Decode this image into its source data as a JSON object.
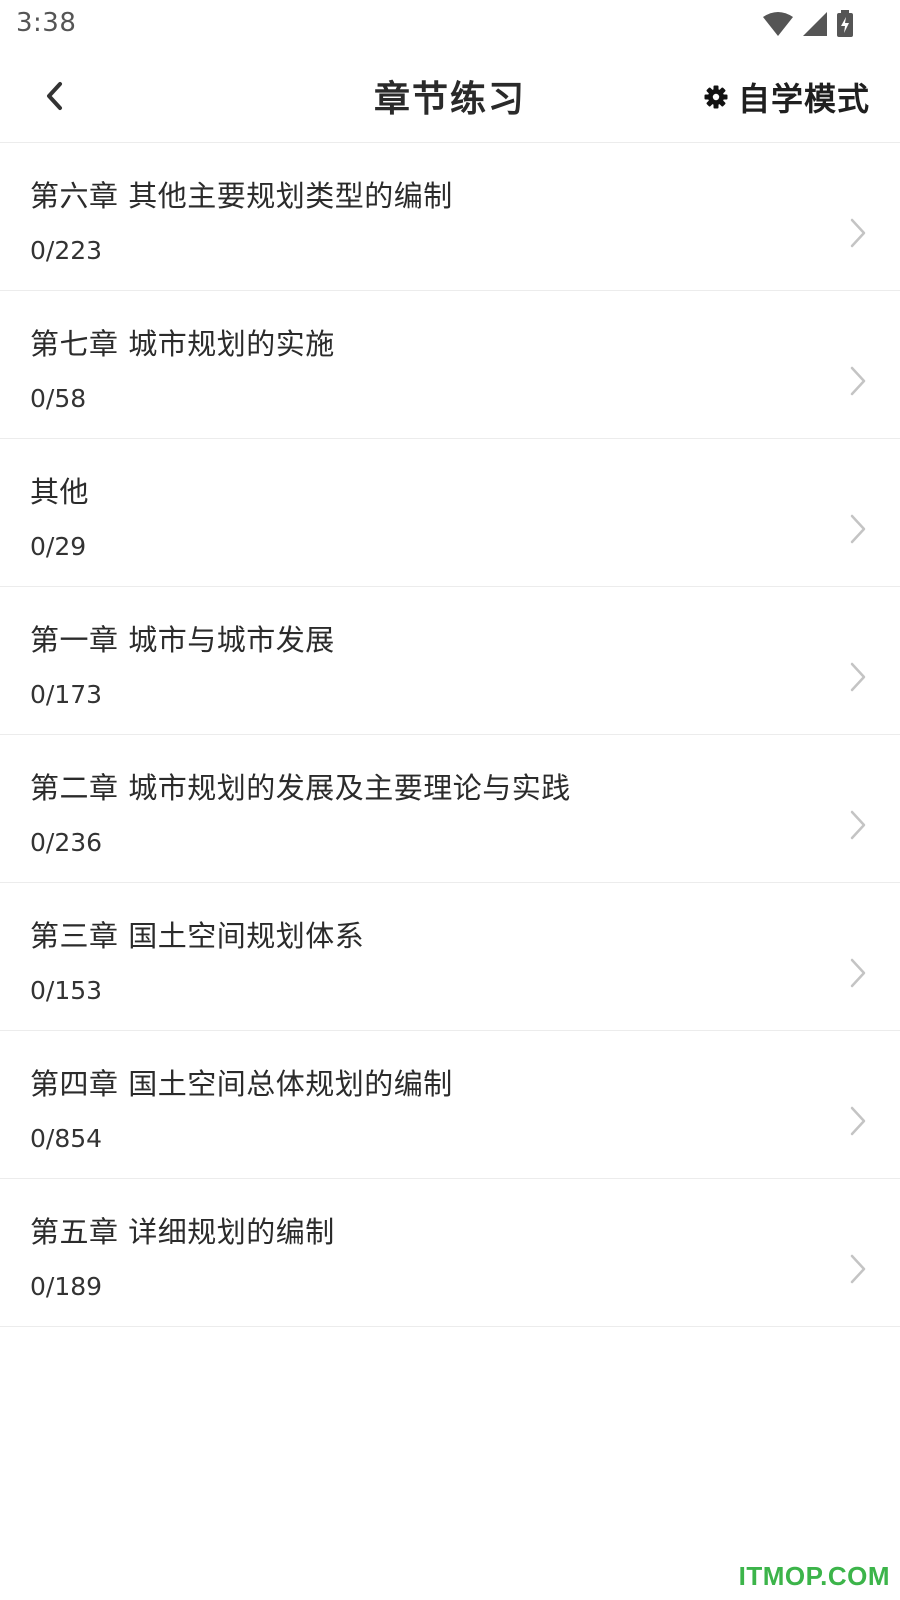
{
  "status_bar": {
    "time": "3:38",
    "icons": [
      "wifi-icon",
      "cell-signal-icon",
      "battery-charging-icon"
    ]
  },
  "header": {
    "title": "章节练习",
    "mode_label": "自学模式",
    "back_icon": "chevron-left-icon",
    "mode_icon": "gear-icon"
  },
  "chapters": [
    {
      "title": "第六章 其他主要规划类型的编制",
      "progress": "0/223"
    },
    {
      "title": "第七章 城市规划的实施",
      "progress": "0/58"
    },
    {
      "title": "其他",
      "progress": "0/29"
    },
    {
      "title": "第一章 城市与城市发展",
      "progress": "0/173"
    },
    {
      "title": "第二章 城市规划的发展及主要理论与实践",
      "progress": "0/236"
    },
    {
      "title": "第三章 国土空间规划体系",
      "progress": "0/153"
    },
    {
      "title": "第四章 国土空间总体规划的编制",
      "progress": "0/854"
    },
    {
      "title": "第五章 详细规划的编制",
      "progress": "0/189"
    }
  ],
  "watermark": "ITMOP.COM",
  "colors": {
    "watermark": "#3cb44a",
    "divider": "#ececec",
    "chevron": "#c4c4c4"
  }
}
